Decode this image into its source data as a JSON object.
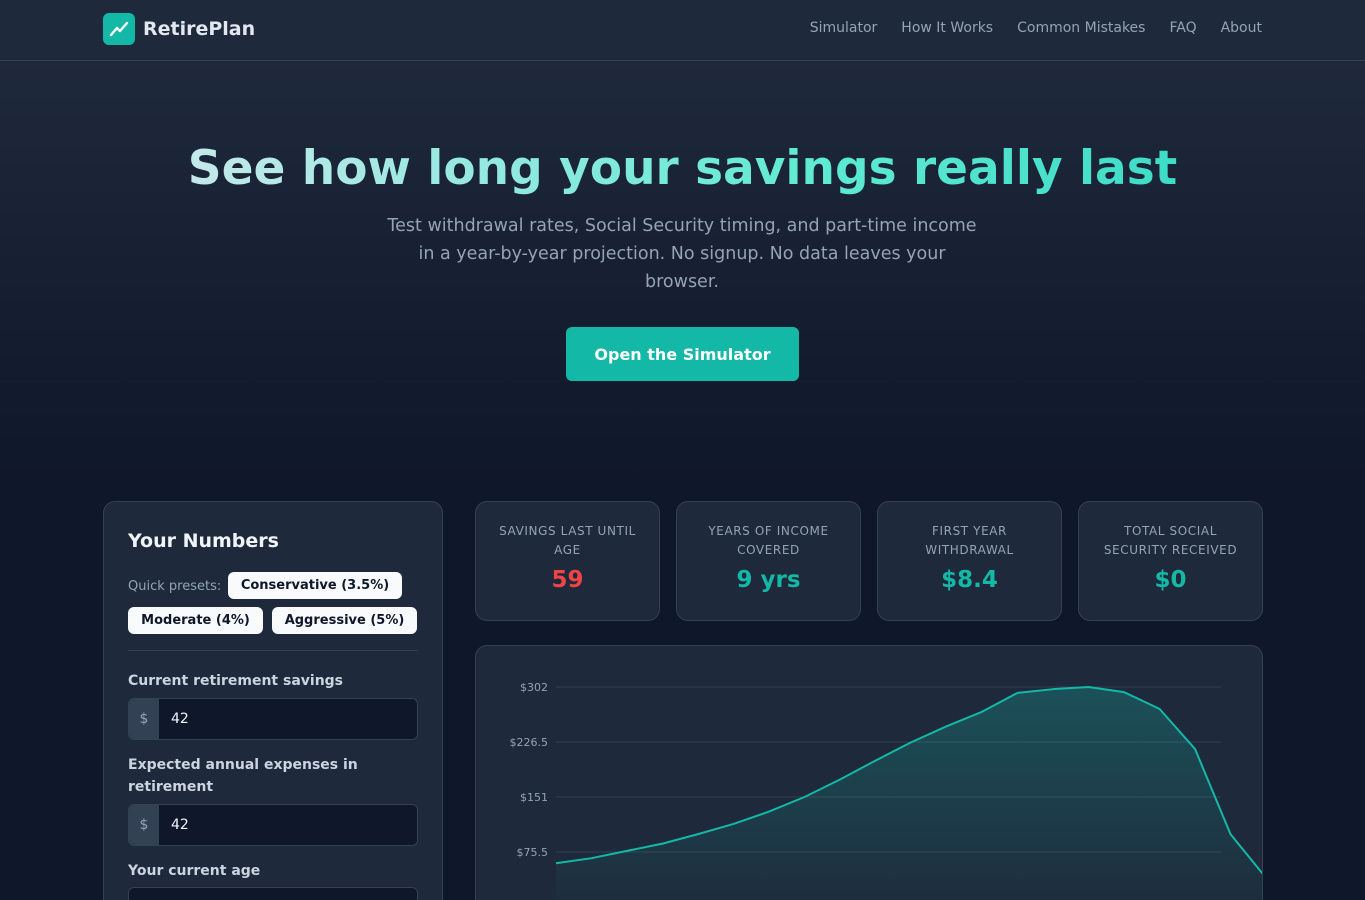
{
  "brand": {
    "name": "RetirePlan",
    "logo_icon": "trend-line-icon"
  },
  "nav": [
    "Simulator",
    "How It Works",
    "Common Mistakes",
    "FAQ",
    "About"
  ],
  "hero": {
    "title": "See how long your savings really last",
    "subtitle": "Test withdrawal rates, Social Security timing, and part-time income in a year-by-year projection. No signup. No data leaves your browser.",
    "cta": "Open the Simulator"
  },
  "panel": {
    "title": "Your Numbers",
    "presets_label": "Quick presets:",
    "presets": [
      "Conservative (3.5%)",
      "Moderate (4%)",
      "Aggressive (5%)"
    ],
    "fields": [
      {
        "label": "Current retirement savings",
        "prefix": "$",
        "value": "42"
      },
      {
        "label": "Expected annual expenses in retirement",
        "prefix": "$",
        "value": "42"
      },
      {
        "label": "Your current age",
        "prefix": "",
        "value": ""
      }
    ]
  },
  "stats": [
    {
      "label": "Savings last until age",
      "value": "59",
      "color": "#ef4444"
    },
    {
      "label": "Years of income covered",
      "value": "9 yrs",
      "color": "#14b8a6"
    },
    {
      "label": "First year withdrawal",
      "value": "$8.4",
      "color": "#14b8a6"
    },
    {
      "label": "Total Social Security received",
      "value": "$0",
      "color": "#14b8a6"
    }
  ],
  "colors": {
    "accent": "#14b8a6",
    "danger": "#ef4444",
    "background": "#0f172a",
    "card": "#1e293b",
    "border": "#334155"
  },
  "chart_data": {
    "type": "area",
    "y_tick_labels": [
      "$302",
      "$226.5",
      "$151",
      "$75.5"
    ],
    "y_ticks": [
      302,
      226.5,
      151,
      75.5
    ],
    "ylim": [
      0,
      302
    ],
    "grid": true,
    "series": [
      {
        "values": [
          60,
          67,
          77,
          87,
          100,
          114,
          131,
          151,
          175,
          201,
          226,
          248,
          268,
          294,
          299,
          302,
          295,
          272,
          217,
          100,
          40
        ]
      }
    ]
  }
}
